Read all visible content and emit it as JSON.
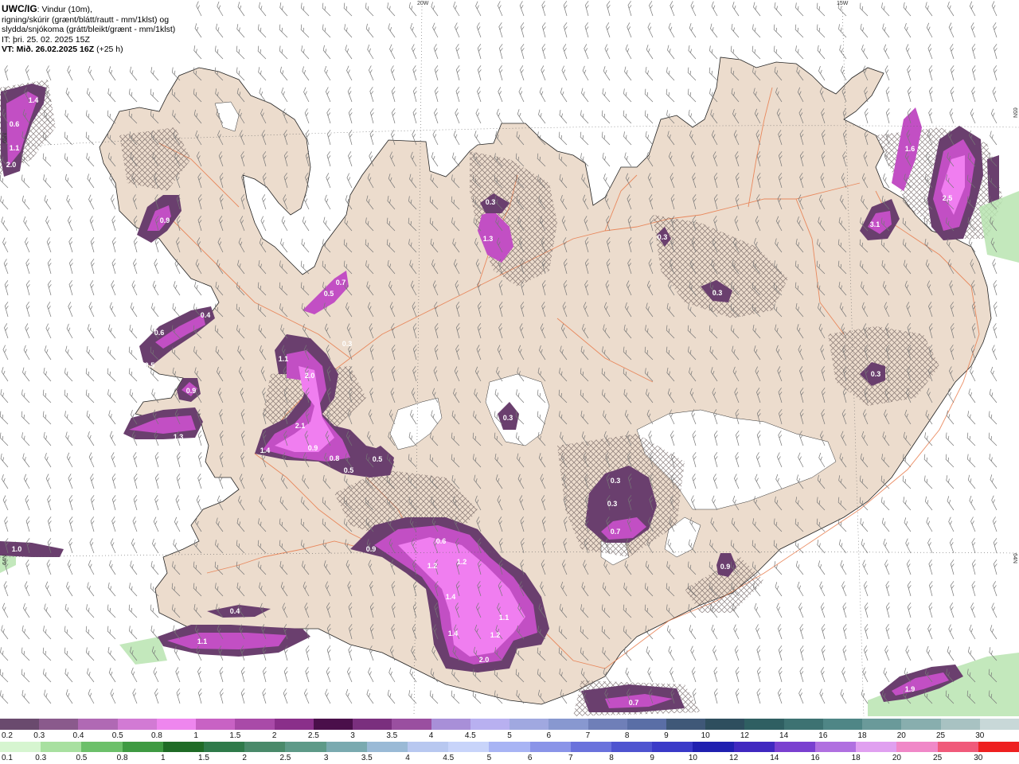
{
  "header": {
    "model": "UWC/IG",
    "description_line1": ": Vindur (10m),",
    "description_line2": "rigning/skúrir (grænt/blátt/rautt - mm/1klst) og",
    "description_line3": "slydda/snjókoma (grátt/bleikt/grænt - mm/1klst)",
    "init_time": "IT: þri. 25. 02. 2025 15Z",
    "valid_time": "VT: Mið. 26.02.2025 16Z",
    "lead": " (+25 h)"
  },
  "graticule": {
    "lon1": "20W",
    "lon2": "15W",
    "lat1_left": "65N",
    "lat1_right": "65N",
    "lat2_left": "64N",
    "lat2_right": "64N"
  },
  "colors": {
    "sea": "#ffffff",
    "land": "#ecdccd",
    "roads": "#e87a4a",
    "glacier": "#ffffff",
    "precip_light": "#6a3f6e",
    "precip_mid": "#c24fc4",
    "precip_high": "#f07ef0"
  },
  "precip_labels": [
    {
      "id": "p1",
      "text": "1.4"
    },
    {
      "id": "p2",
      "text": "0.6"
    },
    {
      "id": "p3",
      "text": "1.1"
    },
    {
      "id": "p4",
      "text": "2.0"
    },
    {
      "id": "p5",
      "text": "0.9"
    },
    {
      "id": "p6",
      "text": "0.7"
    },
    {
      "id": "p7",
      "text": "0.5"
    },
    {
      "id": "p8",
      "text": "0.4"
    },
    {
      "id": "p9",
      "text": "0.6"
    },
    {
      "id": "p10",
      "text": "0.5"
    },
    {
      "id": "p11",
      "text": "1.1"
    },
    {
      "id": "p12",
      "text": "2.0"
    },
    {
      "id": "p13",
      "text": "0.3"
    },
    {
      "id": "p14",
      "text": "0.9"
    },
    {
      "id": "p15",
      "text": "1.3"
    },
    {
      "id": "p16",
      "text": "2.1"
    },
    {
      "id": "p17",
      "text": "1.4"
    },
    {
      "id": "p18",
      "text": "0.9"
    },
    {
      "id": "p19",
      "text": "0.8"
    },
    {
      "id": "p20",
      "text": "0.5"
    },
    {
      "id": "p21",
      "text": "0.5"
    },
    {
      "id": "p22",
      "text": "1.3"
    },
    {
      "id": "p23",
      "text": "0.3"
    },
    {
      "id": "p24",
      "text": "0.3"
    },
    {
      "id": "p25",
      "text": "0.3"
    },
    {
      "id": "p26",
      "text": "1.6"
    },
    {
      "id": "p27",
      "text": "2.5"
    },
    {
      "id": "p28",
      "text": "3.1"
    },
    {
      "id": "p29",
      "text": "0.3"
    },
    {
      "id": "p30",
      "text": "0.3"
    },
    {
      "id": "p31",
      "text": "0.3"
    },
    {
      "id": "p32",
      "text": "0.7"
    },
    {
      "id": "p33",
      "text": "0.3"
    },
    {
      "id": "p34",
      "text": "0.9"
    },
    {
      "id": "p35",
      "text": "0.6"
    },
    {
      "id": "p36",
      "text": "1.2"
    },
    {
      "id": "p37",
      "text": "1.2"
    },
    {
      "id": "p38",
      "text": "1.4"
    },
    {
      "id": "p39",
      "text": "1.1"
    },
    {
      "id": "p40",
      "text": "1.2"
    },
    {
      "id": "p41",
      "text": "1.4"
    },
    {
      "id": "p42",
      "text": "2.0"
    },
    {
      "id": "p43",
      "text": "1.0"
    },
    {
      "id": "p44",
      "text": "0.4"
    },
    {
      "id": "p45",
      "text": "1.1"
    },
    {
      "id": "p46",
      "text": "0.7"
    },
    {
      "id": "p47",
      "text": "1.9"
    },
    {
      "id": "p48",
      "text": "0.9"
    }
  ],
  "legend": {
    "snow_labels": [
      "0.2",
      "0.3",
      "0.4",
      "0.5",
      "0.8",
      "1",
      "1.5",
      "2",
      "2.5",
      "3",
      "3.5",
      "4",
      "4.5",
      "5",
      "6",
      "7",
      "8",
      "9",
      "10",
      "12",
      "14",
      "16",
      "18",
      "20",
      "25",
      "30"
    ],
    "snow_colors": [
      "#6a4a6e",
      "#8a5a8c",
      "#b069b4",
      "#d27ad4",
      "#ee86ee",
      "#c862c4",
      "#a94aa8",
      "#8a2f8a",
      "#4a0f4a",
      "#7a2f7e",
      "#9a4fa0",
      "#a88fd8",
      "#b8b0f0",
      "#a0a8e0",
      "#8898d0",
      "#6f7fb8",
      "#5a6ea6",
      "#3f5878",
      "#2e4e5e",
      "#2f5f62",
      "#3d7272",
      "#4f8686",
      "#6a9a9a",
      "#88aeae",
      "#a8c2c2",
      "#c8d8d8"
    ],
    "rain_labels": [
      "0.1",
      "0.3",
      "0.5",
      "0.8",
      "1",
      "1.5",
      "2",
      "2.5",
      "3",
      "3.5",
      "4",
      "4.5",
      "5",
      "6",
      "7",
      "8",
      "9",
      "10",
      "12",
      "14",
      "16",
      "18",
      "20",
      "25",
      "30"
    ],
    "rain_colors": [
      "#d6f5d0",
      "#a8e0a0",
      "#6cc06a",
      "#3e9a42",
      "#1f6b26",
      "#2f7a4a",
      "#4a8a6a",
      "#5e9a88",
      "#7aaab0",
      "#9abad6",
      "#b8c8f0",
      "#c8d4fa",
      "#a8b4f4",
      "#8a94e8",
      "#6a72dc",
      "#4e54d0",
      "#3a3ac8",
      "#2020b0",
      "#4028c0",
      "#7a40d0",
      "#b070e0",
      "#e0a0f0",
      "#f088c8",
      "#f05a7a",
      "#ee2020"
    ]
  }
}
